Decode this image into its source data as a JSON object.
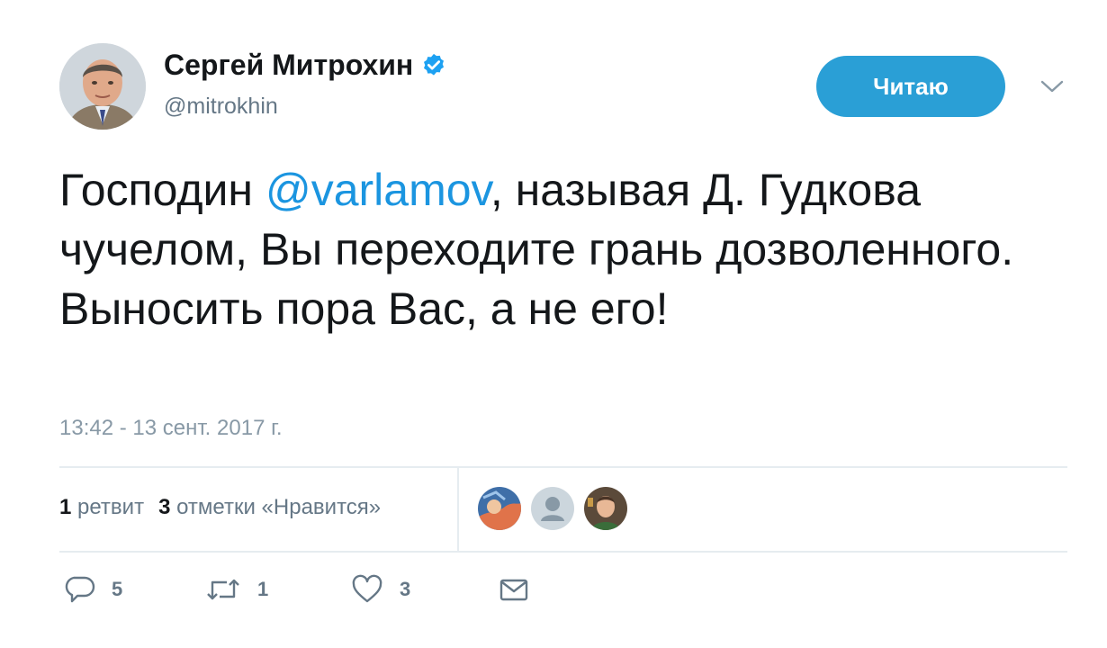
{
  "user": {
    "display_name": "Сергей Митрохин",
    "handle": "@mitrokhin",
    "verified_icon": "verified-badge-icon"
  },
  "follow_button": {
    "label": "Читаю"
  },
  "menu": {
    "icon": "chevron-down-icon"
  },
  "tweet": {
    "text_before": "Господин ",
    "mention": "@varlamov",
    "text_after": ", называя Д. Гудкова чучелом, Вы переходите грань дозволенного. Выносить пора Вас, а не его!",
    "timestamp": "13:42 - 13 сент. 2017 г."
  },
  "stats": {
    "retweets_count": "1",
    "retweets_label": "ретвит",
    "likes_count": "3",
    "likes_label": "отметки «Нравится»"
  },
  "actions": {
    "reply_count": "5",
    "retweet_count": "1",
    "like_count": "3"
  },
  "colors": {
    "accent": "#1b95e0",
    "follow_bg": "#2a9fd6",
    "muted": "#657786"
  }
}
